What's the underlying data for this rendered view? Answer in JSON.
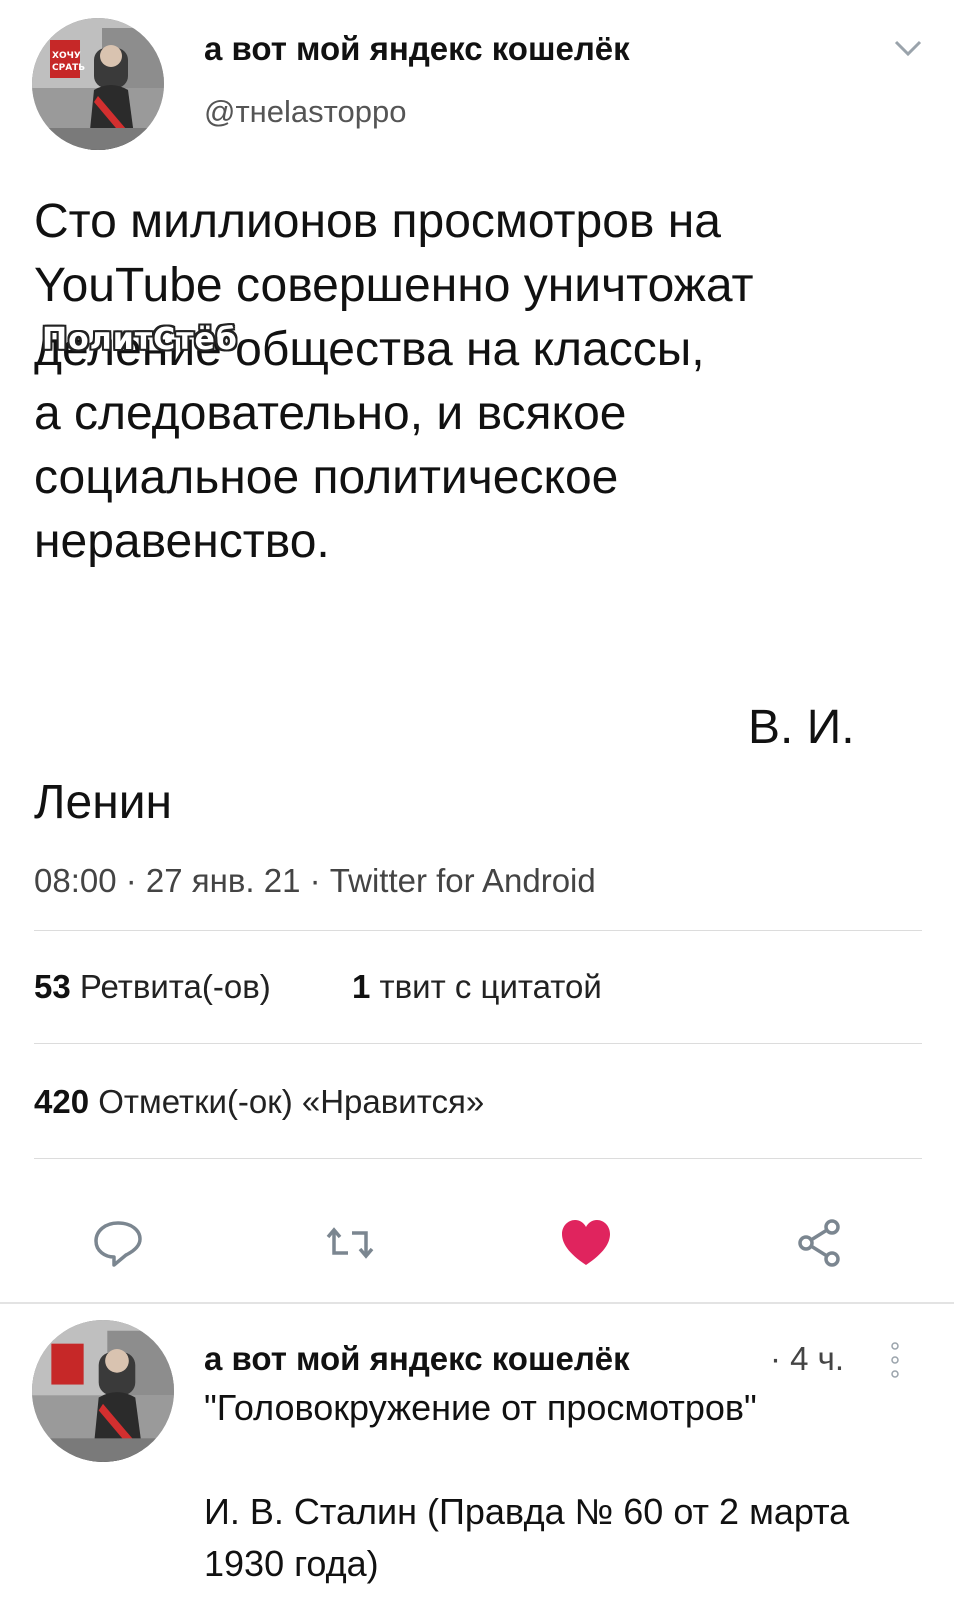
{
  "tweet": {
    "author_name": "а вот мой яндекс кошелёк",
    "author_handle": "@тнеlаsтоppо",
    "body": "Сто миллионов просмотров на\nYouTube совершенно уничтожат\nделение общества на классы,\nа следовательно, и всякое\nсоциальное политическое\nнеравенство.",
    "signature_initials": "В. И.",
    "signature_name": "Ленин",
    "meta": "08:00 · 27 янв. 21 · Twitter for Android",
    "retweets_count": "53",
    "retweets_label": "Ретвита(-ов)",
    "quotes_count": "1",
    "quotes_label": "твит с цитатой",
    "likes_count": "420",
    "likes_label": "Отметки(-ок) «Нравится»",
    "like_color": "#e0245e"
  },
  "watermark": "ПолитСтёб",
  "avatar": {
    "sign_text": "ХОЧУ СРАТЬ"
  },
  "reply": {
    "author_name": "а вот мой яндекс кошелёк",
    "time": "· 4 ч.",
    "text": "\"Головокружение от просмотров\"\n\nИ. В. Сталин (Правда № 60 от 2 марта\n1930 года)"
  }
}
